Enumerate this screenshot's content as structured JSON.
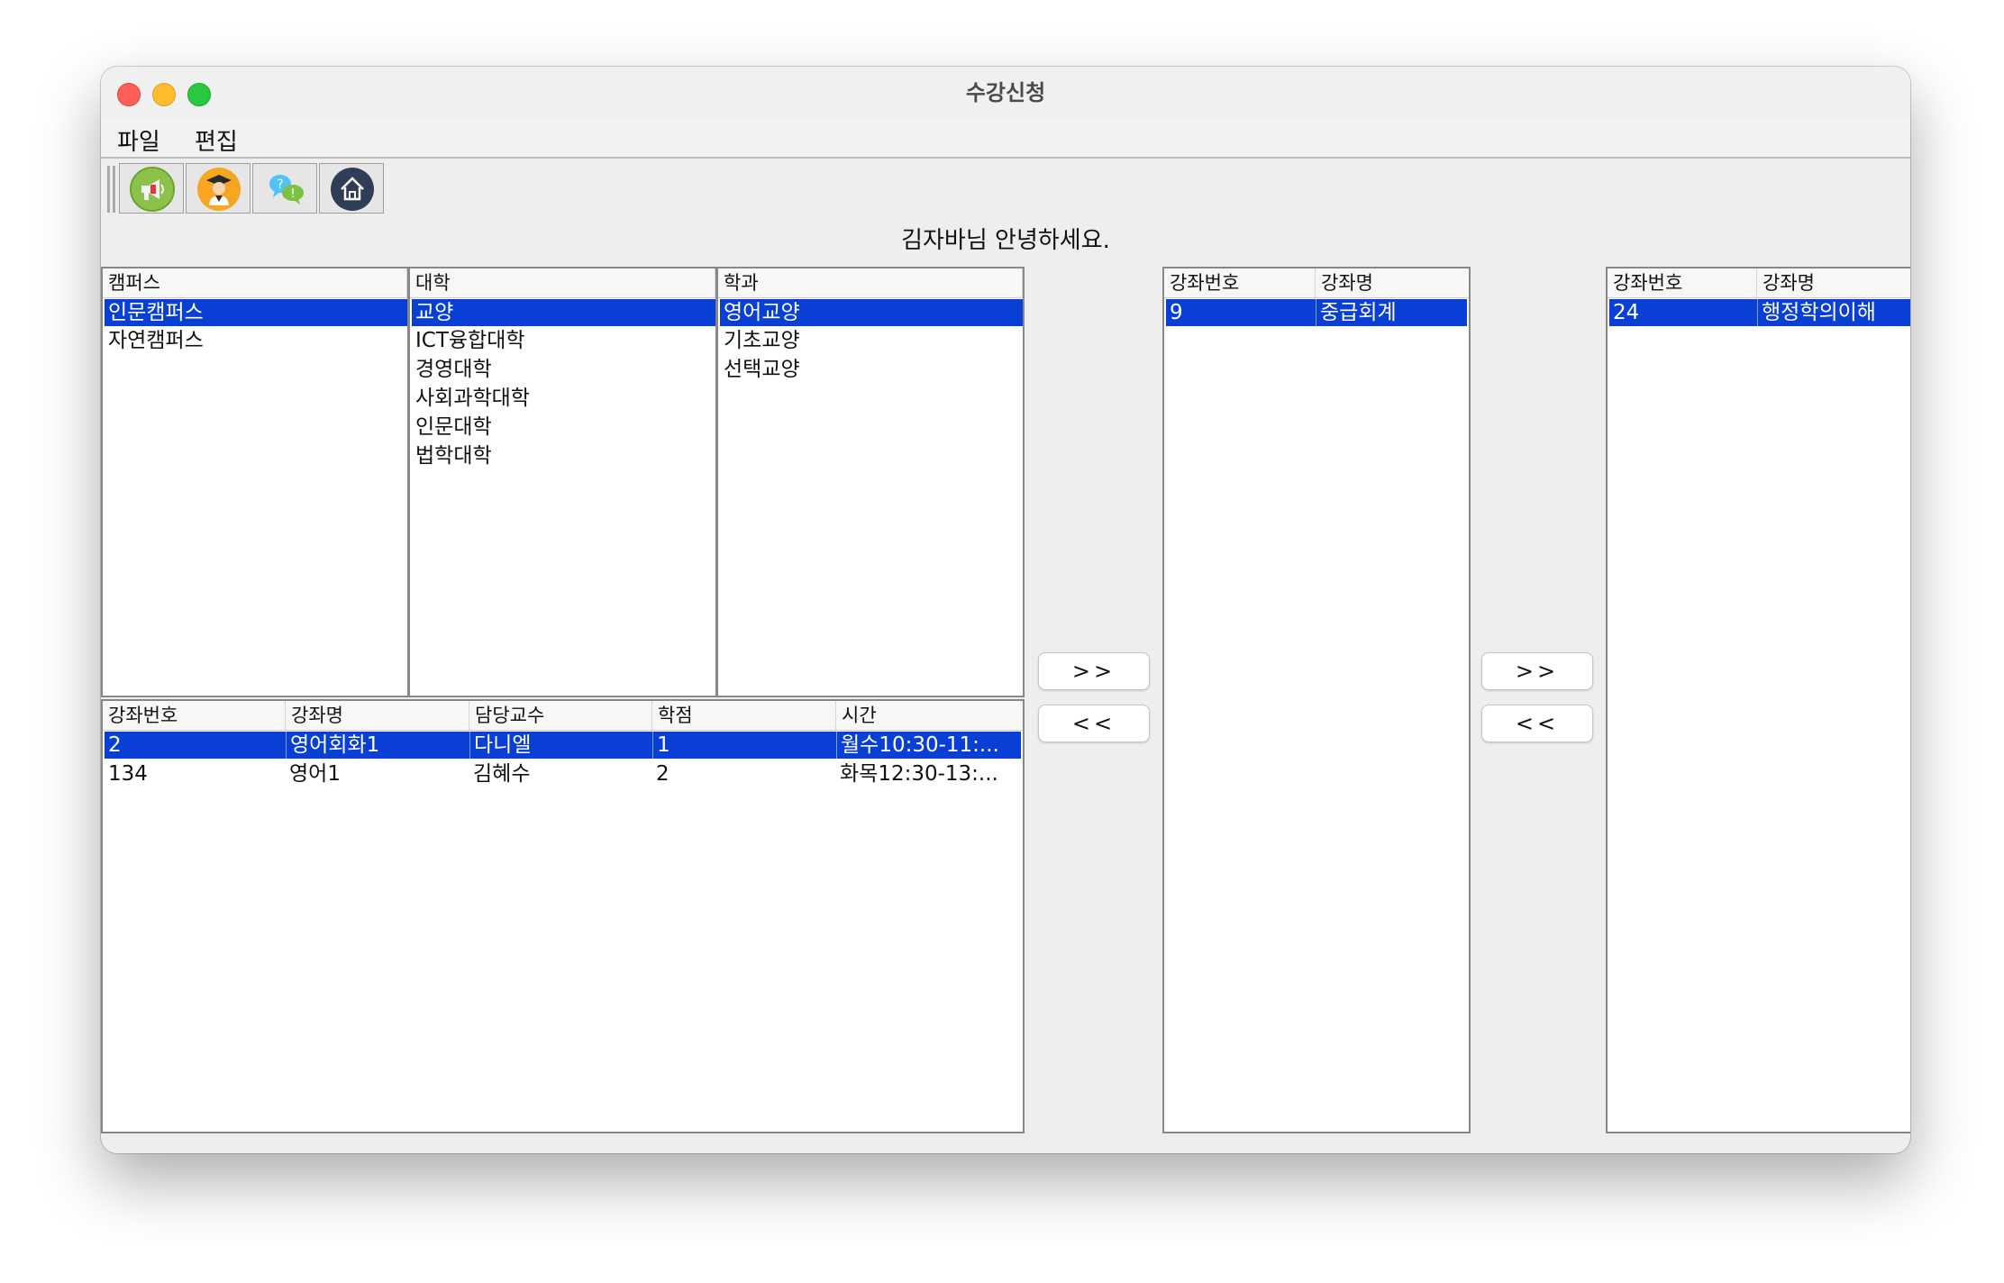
{
  "window": {
    "title": "수강신청"
  },
  "menu": {
    "items": [
      "파일",
      "편집"
    ]
  },
  "toolbar": {
    "buttons": [
      {
        "icon": "megaphone-icon",
        "color": "#8bc34a"
      },
      {
        "icon": "graduate-icon",
        "color": "#f6a623"
      },
      {
        "icon": "chat-icon",
        "color": "#4fc3f7"
      },
      {
        "icon": "home-icon",
        "color": "#2f3e56"
      }
    ]
  },
  "welcome": "김자바님 안녕하세요.",
  "campus": {
    "header": "캠퍼스",
    "items": [
      "인문캠퍼스",
      "자연캠퍼스"
    ],
    "selected": 0
  },
  "college": {
    "header": "대학",
    "items": [
      "교양",
      "ICT융합대학",
      "경영대학",
      "사회과학대학",
      "인문대학",
      "법학대학"
    ],
    "selected": 0
  },
  "department": {
    "header": "학과",
    "items": [
      "영어교양",
      "기초교양",
      "선택교양"
    ],
    "selected": 0
  },
  "courses": {
    "headers": [
      "강좌번호",
      "강좌명",
      "담당교수",
      "학점",
      "시간"
    ],
    "rows": [
      [
        "2",
        "영어회화1",
        "다니엘",
        "1",
        "월수10:30-11:..."
      ],
      [
        "134",
        "영어1",
        "김혜수",
        "2",
        "화목12:30-13:..."
      ]
    ],
    "selected": 0
  },
  "middle": {
    "headers": [
      "강좌번호",
      "강좌명"
    ],
    "rows": [
      [
        "9",
        "중급회계"
      ]
    ],
    "selected": 0
  },
  "right": {
    "headers": [
      "강좌번호",
      "강좌명"
    ],
    "rows": [
      [
        "24",
        "행정학의이해"
      ]
    ],
    "selected": 0
  },
  "buttons": {
    "add": ">>",
    "remove": "<<"
  },
  "colors": {
    "selection": "#0a3fd6"
  }
}
